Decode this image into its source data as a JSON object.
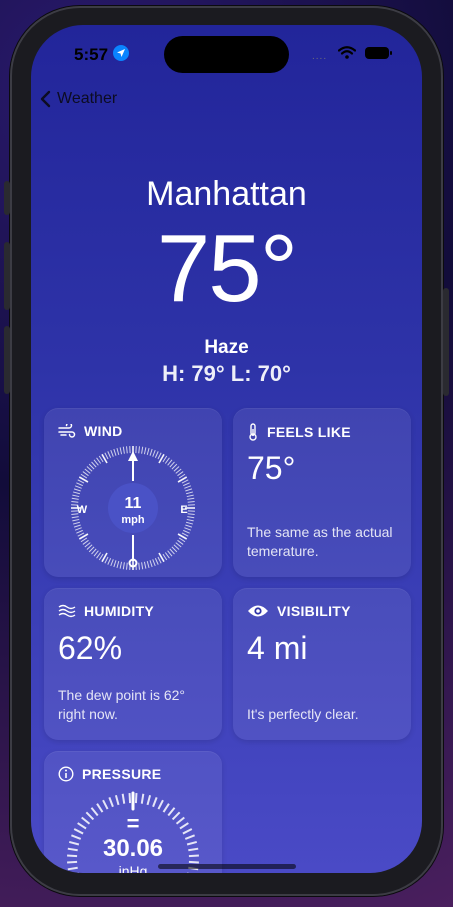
{
  "status": {
    "time": "5:57",
    "signal": "...."
  },
  "nav": {
    "back_label": "Weather"
  },
  "current": {
    "city": "Manhattan",
    "temperature": "75°",
    "condition": "Haze",
    "hilo": "H: 79°  L: 70°"
  },
  "cards": {
    "wind": {
      "title": "WIND",
      "speed": "11",
      "unit": "mph",
      "west": "W",
      "east": "E"
    },
    "feels_like": {
      "title": "FEELS LIKE",
      "value": "75°",
      "desc": "The same as the actual temerature."
    },
    "humidity": {
      "title": "HUMIDITY",
      "value": "62%",
      "desc": "The dew point is 62° right now."
    },
    "visibility": {
      "title": "VISIBILITY",
      "value": "4 mi",
      "desc": "It's perfectly clear."
    },
    "pressure": {
      "title": "PRESSURE",
      "symbol": "=",
      "value": "30.06",
      "unit": "inHg"
    }
  },
  "colors": {
    "accent": "#0a84ff",
    "gradient_top": "#22259a",
    "gradient_bottom": "#4a4ac6"
  }
}
